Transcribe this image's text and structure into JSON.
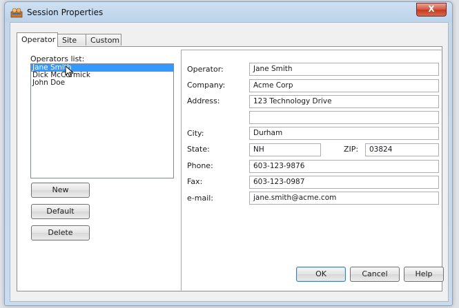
{
  "window": {
    "title": "Session Properties",
    "close_symbol": "X"
  },
  "tabs": [
    {
      "label": "Operator",
      "active": true
    },
    {
      "label": "Site",
      "active": false
    },
    {
      "label": "Custom",
      "active": false
    }
  ],
  "operators": {
    "label": "Operators list:",
    "items": [
      "Jane Smith",
      "Dick McCormick",
      "John Doe"
    ],
    "selected_index": 0
  },
  "buttons": {
    "new": "New",
    "default": "Default",
    "delete": "Delete"
  },
  "form": {
    "operator_label": "Operator:",
    "operator": "Jane Smith",
    "company_label": "Company:",
    "company": "Acme Corp",
    "address_label": "Address:",
    "address1": "123 Technology Drive",
    "address2": "",
    "city_label": "City:",
    "city": "Durham",
    "state_label": "State:",
    "state": "NH",
    "zip_label": "ZIP:",
    "zip": "03824",
    "phone_label": "Phone:",
    "phone": "603-123-9876",
    "fax_label": "Fax:",
    "fax": "603-123-0987",
    "email_label": "e-mail:",
    "email": "jane.smith@acme.com"
  },
  "footer": {
    "ok": "OK",
    "cancel": "Cancel",
    "help": "Help"
  }
}
